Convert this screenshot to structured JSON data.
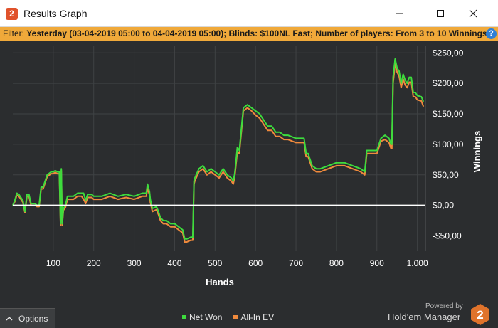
{
  "window": {
    "title": "Results Graph",
    "app_icon_glyph": "2",
    "minimize_icon": "minimize-icon",
    "maximize_icon": "maximize-icon",
    "close_icon": "close-icon"
  },
  "filter": {
    "prefix": "Filter:",
    "text": "Yesterday (03-04-2019 05:00 to 04-04-2019 05:00); Blinds: $100NL Fast; Number of players: From 3 to 10  Winnings",
    "help_glyph": "?"
  },
  "options": {
    "label": "Options",
    "icon": "chevron-up-icon"
  },
  "branding": {
    "powered_by": "Powered by",
    "product": "Hold'em Manager",
    "logo_glyph": "2"
  },
  "colors": {
    "net_won": "#3ddc3d",
    "all_in_ev": "#f08a3c",
    "zero_line": "#ffffff",
    "grid": "#3f4244",
    "background": "#2b2d2f",
    "filter_bar": "#f0a93a"
  },
  "chart_data": {
    "type": "line",
    "xlabel": "Hands",
    "ylabel": "Winnings",
    "xlim": [
      0,
      1020
    ],
    "ylim": [
      -75,
      262
    ],
    "x_ticks": [
      100,
      200,
      300,
      400,
      500,
      600,
      700,
      800,
      900,
      1000
    ],
    "x_tick_labels": [
      "100",
      "200",
      "300",
      "400",
      "500",
      "600",
      "700",
      "800",
      "900",
      "1.000"
    ],
    "y_ticks": [
      -50,
      0,
      50,
      100,
      150,
      200,
      250
    ],
    "y_tick_labels": [
      "-$50,00",
      "$0,00",
      "$50,00",
      "$100,00",
      "$150,00",
      "$200,00",
      "$250,00"
    ],
    "grid": true,
    "legend_position": "bottom-center",
    "series": [
      {
        "name": "Net Won",
        "color": "#3ddc3d",
        "x": [
          0,
          5,
          10,
          15,
          25,
          30,
          35,
          40,
          45,
          55,
          60,
          65,
          70,
          75,
          85,
          95,
          100,
          105,
          110,
          115,
          118,
          120,
          122,
          125,
          130,
          135,
          150,
          160,
          170,
          175,
          180,
          185,
          195,
          200,
          220,
          240,
          260,
          280,
          300,
          320,
          330,
          333,
          338,
          340,
          345,
          355,
          360,
          365,
          372,
          380,
          390,
          400,
          410,
          420,
          425,
          430,
          440,
          445,
          448,
          450,
          460,
          470,
          480,
          490,
          500,
          510,
          520,
          530,
          540,
          545,
          548,
          550,
          555,
          560,
          570,
          580,
          590,
          600,
          610,
          620,
          630,
          640,
          650,
          660,
          670,
          680,
          700,
          720,
          725,
          730,
          740,
          750,
          760,
          780,
          800,
          820,
          840,
          860,
          870,
          875,
          880,
          890,
          900,
          910,
          920,
          930,
          935,
          937,
          940,
          945,
          950,
          955,
          960,
          965,
          970,
          975,
          980,
          985,
          990,
          995,
          1000,
          1010,
          1015
        ],
        "y": [
          0,
          8,
          20,
          18,
          8,
          -10,
          18,
          18,
          3,
          3,
          0,
          0,
          30,
          30,
          50,
          55,
          55,
          57,
          55,
          55,
          -30,
          60,
          -30,
          -5,
          0,
          15,
          15,
          20,
          20,
          20,
          8,
          18,
          18,
          15,
          15,
          20,
          15,
          18,
          15,
          20,
          20,
          35,
          22,
          10,
          -5,
          -2,
          -10,
          -20,
          -25,
          -25,
          -30,
          -30,
          -35,
          -40,
          -55,
          -55,
          -52,
          -52,
          40,
          45,
          60,
          65,
          55,
          60,
          55,
          50,
          60,
          50,
          45,
          40,
          50,
          60,
          95,
          90,
          160,
          165,
          160,
          155,
          150,
          140,
          130,
          130,
          120,
          120,
          115,
          115,
          110,
          110,
          85,
          85,
          65,
          60,
          60,
          65,
          70,
          70,
          65,
          60,
          55,
          90,
          90,
          90,
          90,
          110,
          115,
          110,
          100,
          100,
          210,
          240,
          225,
          220,
          200,
          215,
          205,
          200,
          210,
          210,
          185,
          185,
          180,
          178,
          170
        ]
      },
      {
        "name": "All-In EV",
        "color": "#f08a3c",
        "x": [
          0,
          5,
          10,
          15,
          25,
          30,
          35,
          40,
          45,
          55,
          60,
          65,
          70,
          75,
          85,
          95,
          100,
          105,
          110,
          115,
          118,
          120,
          122,
          125,
          130,
          135,
          150,
          160,
          170,
          175,
          180,
          185,
          195,
          200,
          220,
          240,
          260,
          280,
          300,
          320,
          330,
          333,
          338,
          340,
          345,
          355,
          360,
          365,
          372,
          380,
          390,
          400,
          410,
          420,
          425,
          430,
          440,
          445,
          448,
          450,
          460,
          470,
          480,
          490,
          500,
          510,
          520,
          530,
          540,
          545,
          548,
          550,
          555,
          560,
          570,
          580,
          590,
          600,
          610,
          620,
          630,
          640,
          650,
          660,
          670,
          680,
          700,
          720,
          725,
          730,
          740,
          750,
          760,
          780,
          800,
          820,
          840,
          860,
          870,
          875,
          880,
          890,
          900,
          910,
          920,
          930,
          935,
          937,
          940,
          945,
          950,
          955,
          960,
          965,
          970,
          975,
          980,
          985,
          990,
          995,
          1000,
          1010,
          1015
        ],
        "y": [
          0,
          6,
          17,
          15,
          5,
          -12,
          15,
          15,
          0,
          0,
          -2,
          -2,
          27,
          27,
          47,
          52,
          52,
          54,
          52,
          52,
          -33,
          57,
          -33,
          -8,
          -4,
          10,
          10,
          15,
          15,
          10,
          3,
          13,
          13,
          10,
          10,
          15,
          10,
          13,
          10,
          15,
          15,
          28,
          17,
          5,
          -10,
          -7,
          -15,
          -25,
          -30,
          -30,
          -35,
          -35,
          -40,
          -45,
          -60,
          -60,
          -57,
          -57,
          35,
          40,
          55,
          60,
          50,
          55,
          50,
          45,
          55,
          45,
          40,
          35,
          45,
          55,
          88,
          85,
          155,
          160,
          155,
          148,
          143,
          133,
          123,
          123,
          113,
          113,
          108,
          108,
          103,
          103,
          80,
          80,
          60,
          55,
          55,
          60,
          65,
          65,
          60,
          55,
          50,
          85,
          85,
          85,
          85,
          105,
          108,
          103,
          93,
          93,
          200,
          232,
          218,
          212,
          193,
          207,
          197,
          193,
          202,
          202,
          178,
          178,
          173,
          171,
          162
        ]
      }
    ]
  }
}
